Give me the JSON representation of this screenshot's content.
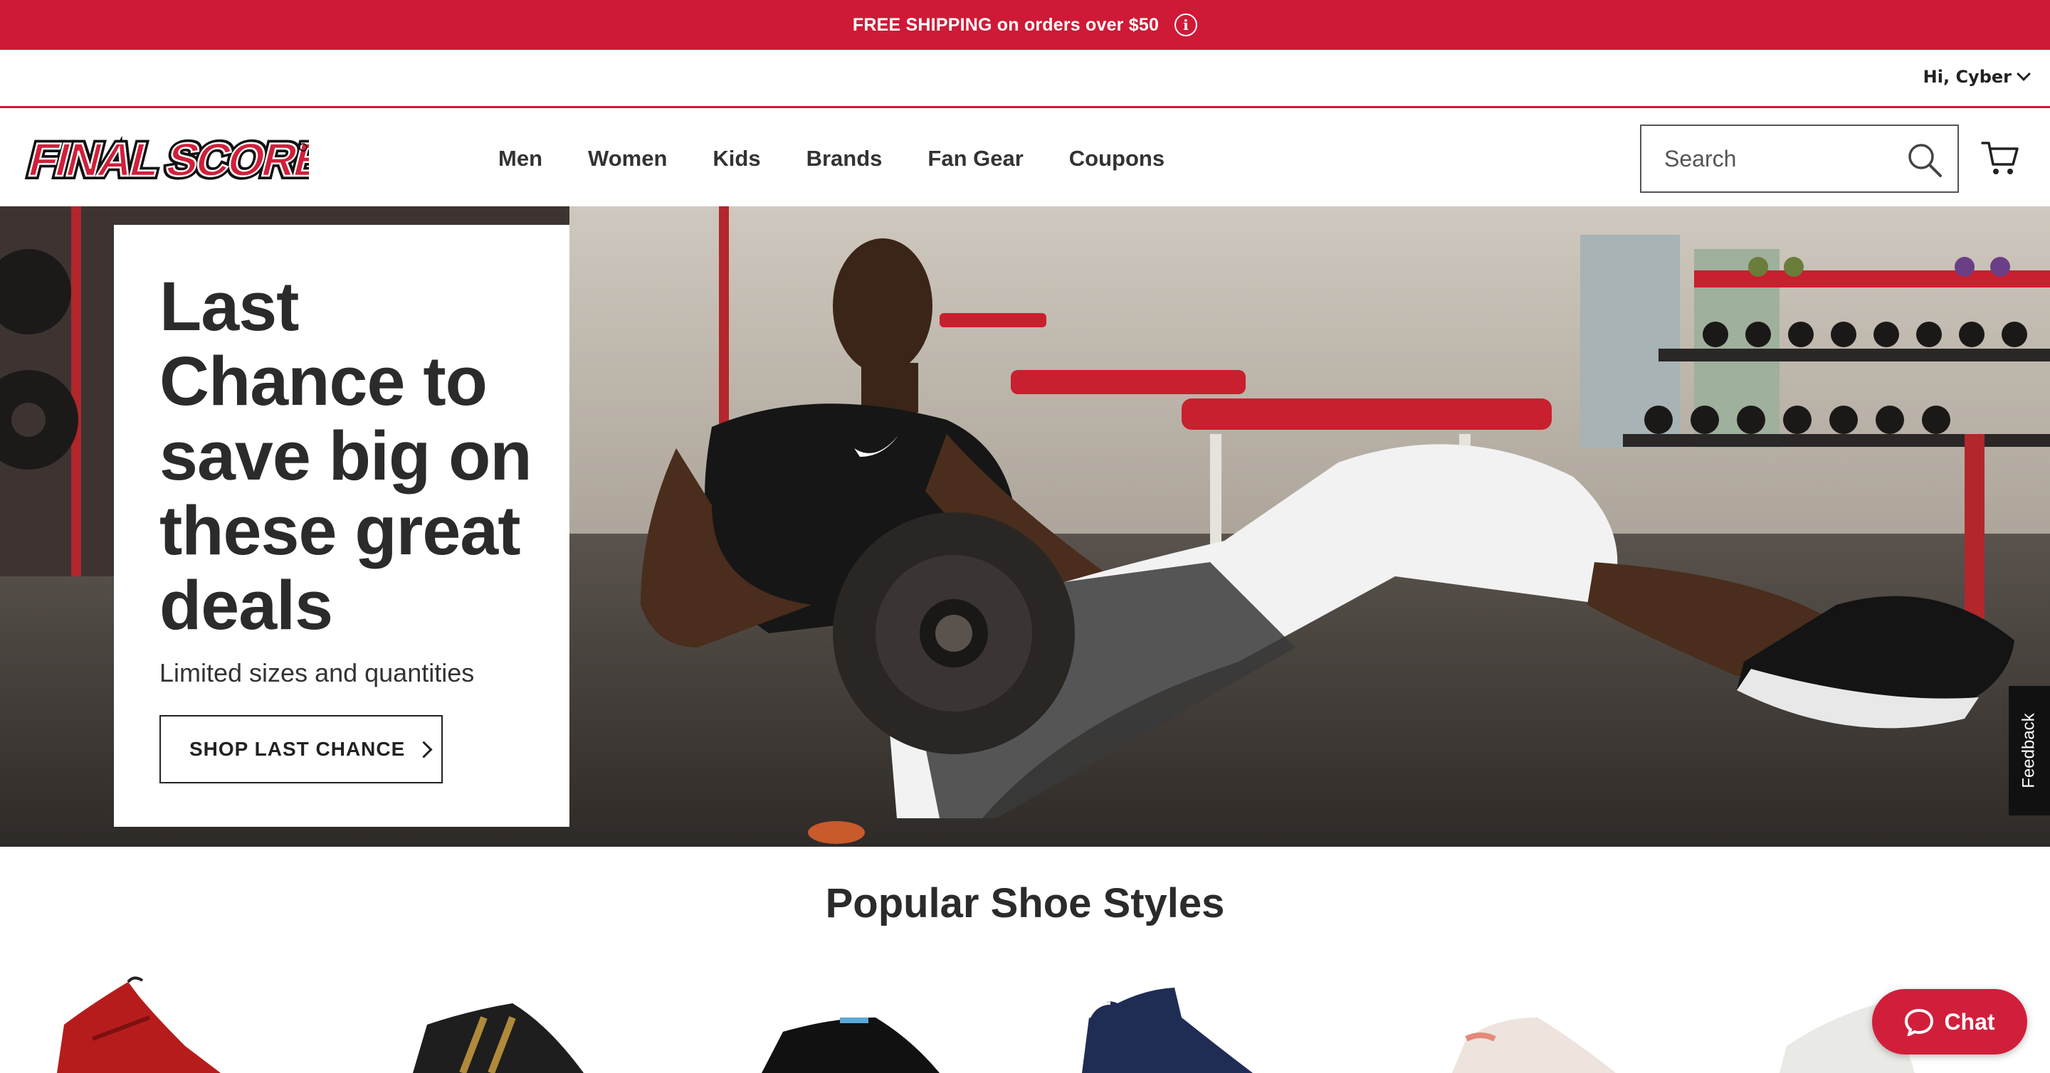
{
  "promo": {
    "text": "FREE SHIPPING on orders over $50",
    "info_icon": "info-icon"
  },
  "account": {
    "greeting": "Hi, Cyber"
  },
  "brand": {
    "logo_text": "FINAL SCORE",
    "accent_color": "#ce1a36"
  },
  "nav": {
    "items": [
      "Men",
      "Women",
      "Kids",
      "Brands",
      "Fan Gear",
      "Coupons"
    ]
  },
  "search": {
    "placeholder": "Search"
  },
  "hero": {
    "title": "Last Chance to save big on these great deals",
    "subtitle": "Limited sizes and quantities",
    "cta_label": "SHOP LAST CHANCE"
  },
  "feedback": {
    "label": "Feedback"
  },
  "popular": {
    "title": "Popular Shoe Styles"
  },
  "chat": {
    "label": "Chat"
  }
}
